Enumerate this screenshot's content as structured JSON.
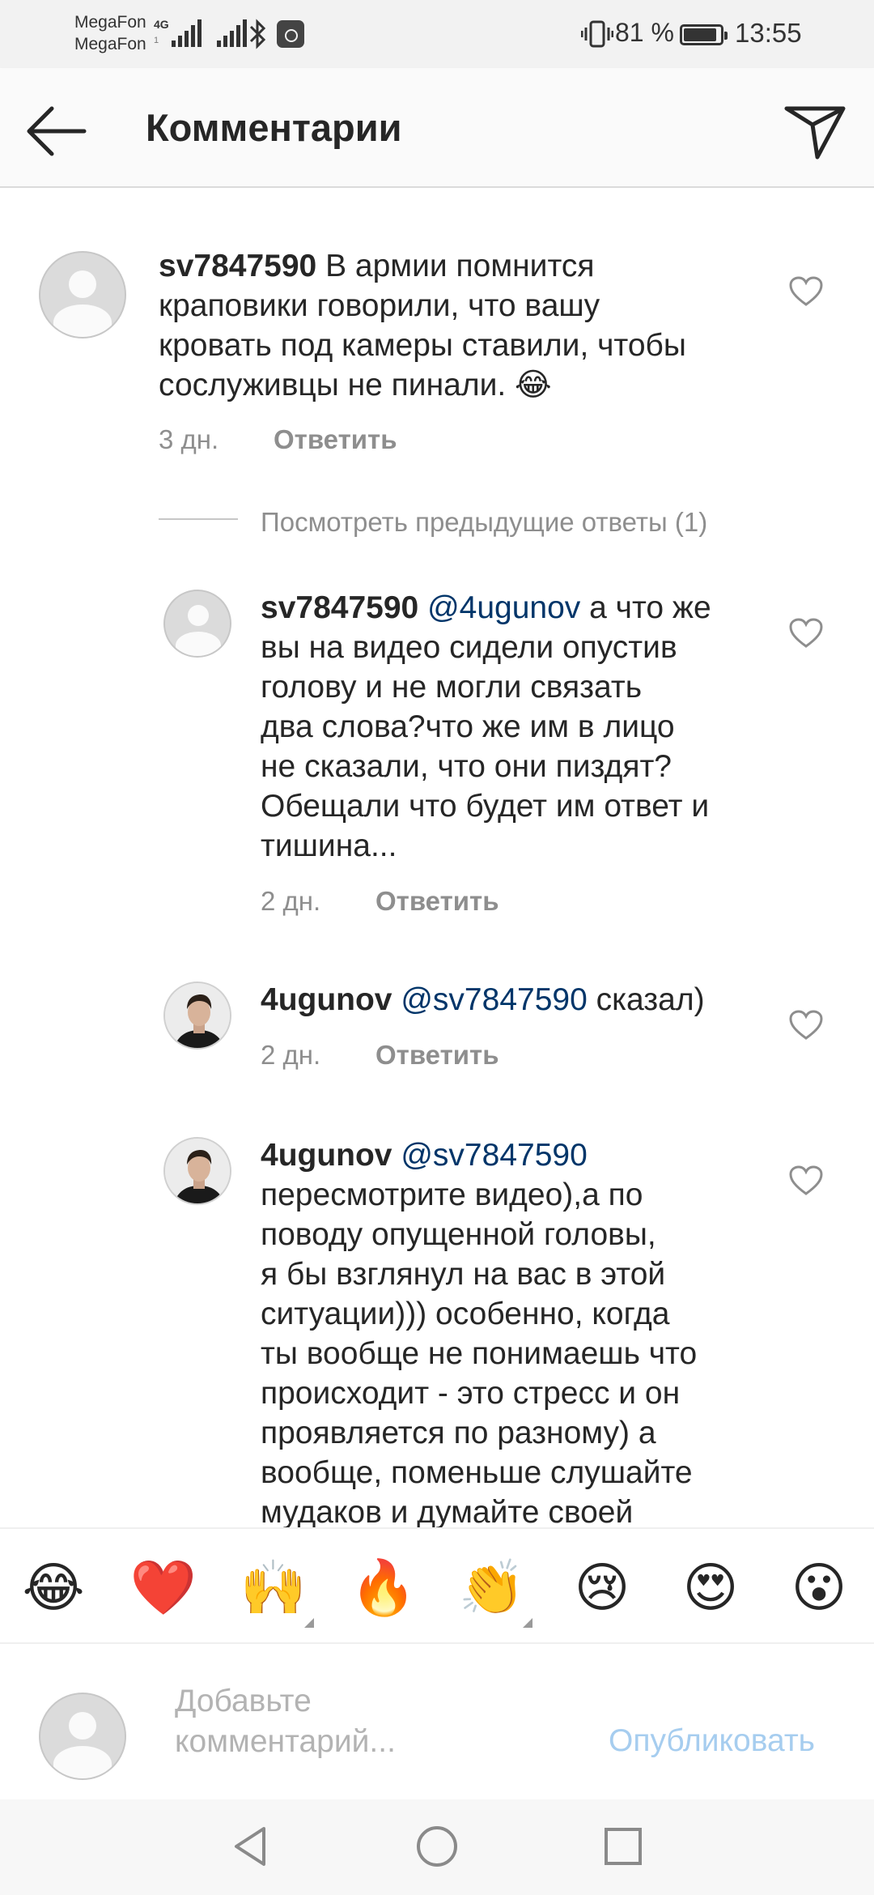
{
  "status_bar": {
    "carrier_1": "MegaFon",
    "carrier_2": "MegaFon",
    "network": "4G",
    "network_2": "1",
    "battery": "81 %",
    "time": "13:55"
  },
  "header": {
    "title": "Комментарии",
    "back_icon": "arrow-left-icon",
    "send_icon": "paper-plane-icon"
  },
  "comments": [
    {
      "username": "sv7847590",
      "lines": [
        "В армии помнится",
        "краповики говорили, что вашу",
        "кровать под камеры ставили, чтобы",
        "сослуживцы не пинали. 😂"
      ],
      "age": "3 дн.",
      "reply": "Ответить"
    },
    {
      "username": "sv7847590",
      "mention": "@4ugunov",
      "lines": [
        "а что же",
        "вы на видео сидели опустив",
        "голову и не могли связать",
        "два слова?что же им в лицо",
        "не сказали, что они пиздят?",
        "Обещали что будет им ответ и",
        "тишина..."
      ],
      "age": "2 дн.",
      "reply": "Ответить"
    },
    {
      "username": "4ugunov",
      "mention": "@sv7847590",
      "lines": [
        "сказал)"
      ],
      "age": "2 дн.",
      "reply": "Ответить"
    },
    {
      "username": "4ugunov",
      "mention": "@sv7847590",
      "lines": [
        "",
        "пересмотрите видео),а по",
        "поводу опущенной головы,",
        "я бы взглянул на вас в этой",
        "ситуации))) особенно, когда",
        "ты вообще не понимаешь что",
        "происходит - это стресс и он",
        "проявляется по разному) а",
        "вообще, поменьше слушайте",
        "мудаков и думайте своей"
      ]
    }
  ],
  "view_previous": "Посмотреть предыдущие ответы (1)",
  "emoji_bar": [
    "😂",
    "❤️",
    "🙌",
    "🔥",
    "👏",
    "😢",
    "😍",
    "😮"
  ],
  "composer": {
    "placeholder_line_1": "Добавьте",
    "placeholder_line_2": "комментарий...",
    "publish": "Опубликовать"
  },
  "colors": {
    "text": "#262626",
    "secondary": "#8e8e8e",
    "mention": "#003569",
    "publish_disabled": "#a6cdef",
    "divider": "#dbdbdb"
  },
  "nav_icons": [
    "back-triangle-icon",
    "home-circle-icon",
    "recents-square-icon"
  ]
}
